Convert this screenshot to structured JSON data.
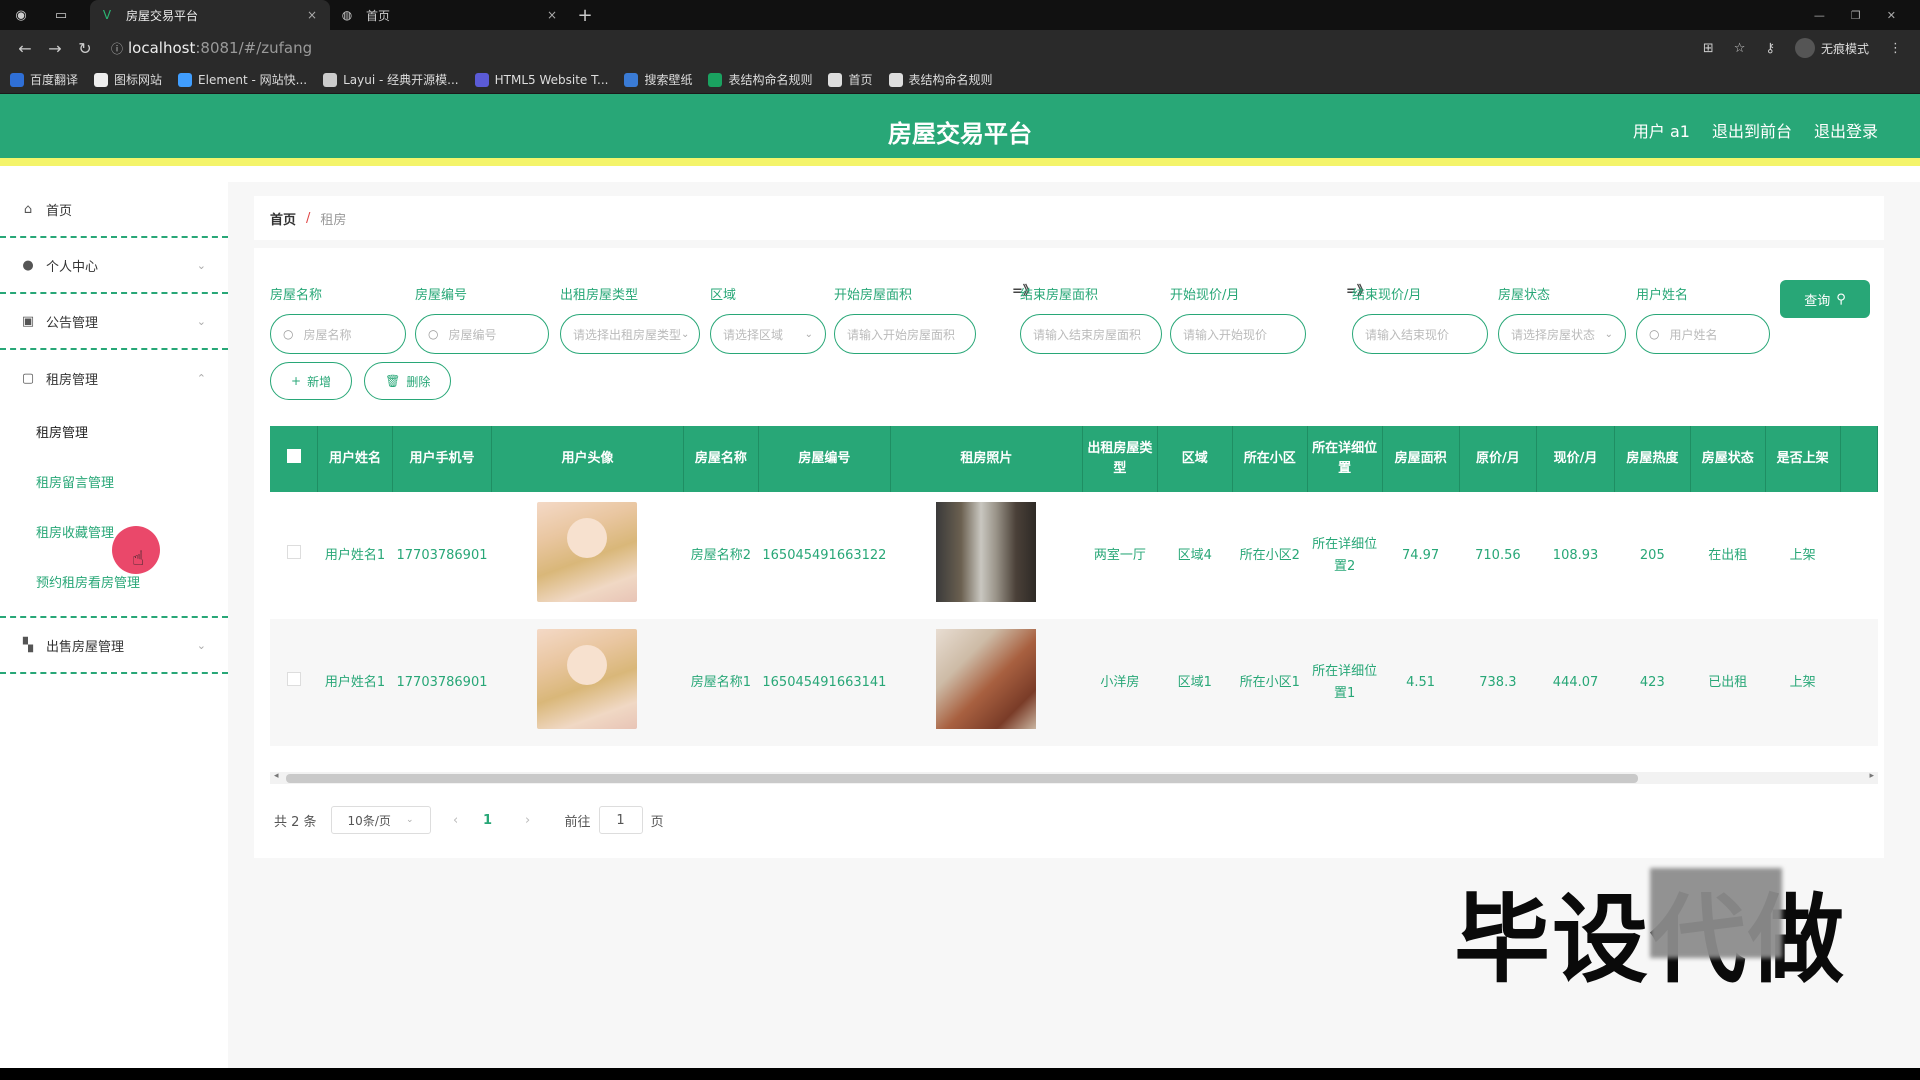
{
  "browser": {
    "tabs": [
      {
        "title": "房屋交易平台"
      },
      {
        "title": "首页"
      }
    ],
    "url_host": "localhost",
    "url_path": ":8081/#/zufang",
    "incognito_label": "无痕模式",
    "bookmarks": [
      {
        "label": "百度翻译",
        "color": "#2f6fd6"
      },
      {
        "label": "图标网站",
        "color": "#eeeeee"
      },
      {
        "label": "Element - 网站快...",
        "color": "#409eff"
      },
      {
        "label": "Layui - 经典开源模...",
        "color": "#cccccc"
      },
      {
        "label": "HTML5 Website T...",
        "color": "#5b5bd6"
      },
      {
        "label": "搜索壁纸",
        "color": "#3a7bd5"
      },
      {
        "label": "表结构命名规则",
        "color": "#1aa260"
      },
      {
        "label": "首页",
        "color": "#dddddd"
      },
      {
        "label": "表结构命名规则",
        "color": "#dddddd"
      }
    ]
  },
  "header": {
    "title": "房屋交易平台",
    "user": "用户 a1",
    "back_front": "退出到前台",
    "logout": "退出登录"
  },
  "sidebar": {
    "home": "首页",
    "personal": "个人中心",
    "notice": "公告管理",
    "rent_group": "租房管理",
    "rent_items": [
      "租房管理",
      "租房留言管理",
      "租房收藏管理",
      "预约租房看房管理"
    ],
    "sale": "出售房屋管理"
  },
  "breadcrumb": {
    "home": "首页",
    "sep": "/",
    "current": "租房"
  },
  "filters": {
    "labels": {
      "name": "房屋名称",
      "code": "房屋编号",
      "type": "出租房屋类型",
      "area": "区域",
      "start_size": "开始房屋面积",
      "end_size": "结束房屋面积",
      "start_price": "开始现价/月",
      "end_price": "结束现价/月",
      "status": "房屋状态",
      "username": "用户姓名"
    },
    "arrow1": "=》",
    "arrow2": "=》",
    "placeholders": {
      "name": "房屋名称",
      "code": "房屋编号",
      "type": "请选择出租房屋类型",
      "area": "请选择区域",
      "start_size": "请输入开始房屋面积",
      "end_size": "请输入结束房屋面积",
      "start_price": "请输入开始现价",
      "end_price": "请输入结束现价",
      "status": "请选择房屋状态",
      "username": "用户姓名"
    },
    "search_btn": "查询"
  },
  "actions": {
    "add": "新增",
    "delete": "删除"
  },
  "table": {
    "headers": [
      "用户姓名",
      "用户手机号",
      "用户头像",
      "房屋名称",
      "房屋编号",
      "租房照片",
      "出租房屋类型",
      "区域",
      "所在小区",
      "所在详细位置",
      "房屋面积",
      "原价/月",
      "现价/月",
      "房屋热度",
      "房屋状态",
      "是否上架"
    ],
    "rows": [
      {
        "username": "用户姓名1",
        "phone": "17703786901",
        "house_name": "房屋名称2",
        "house_code": "165045491663122",
        "type": "两室一厅",
        "area": "区域4",
        "community": "所在小区2",
        "address": "所在详细位置2",
        "size": "74.97",
        "orig_price": "710.56",
        "price": "108.93",
        "hot": "205",
        "status": "在出租",
        "online": "上架"
      },
      {
        "username": "用户姓名1",
        "phone": "17703786901",
        "house_name": "房屋名称1",
        "house_code": "165045491663141",
        "type": "小洋房",
        "area": "区域1",
        "community": "所在小区1",
        "address": "所在详细位置1",
        "size": "4.51",
        "orig_price": "738.3",
        "price": "444.07",
        "hot": "423",
        "status": "已出租",
        "online": "上架"
      }
    ]
  },
  "pager": {
    "total": "共 2 条",
    "page_size": "10条/页",
    "current": "1",
    "goto_label": "前往",
    "goto_value": "1",
    "page_unit": "页"
  },
  "watermark": "毕设代做",
  "colors": {
    "primary": "#28a777",
    "header_border": "#f4f46a"
  }
}
